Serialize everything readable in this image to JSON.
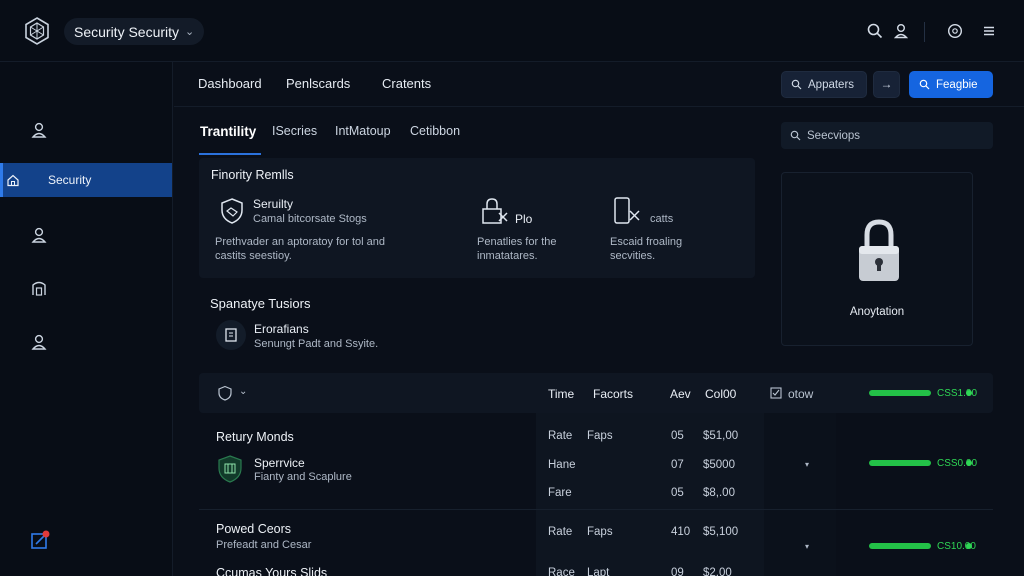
{
  "header": {
    "workspace_label": "Security Security",
    "workspace_chevron": "⌄"
  },
  "nav": {
    "links": [
      "Dashboard",
      "Penlscards",
      "Cratents"
    ],
    "search_button_label": "Appaters",
    "arrow_button_label": "→",
    "primary_button_label": "Feagbie"
  },
  "sidebar": {
    "items": [
      {
        "icon": "user-icon",
        "label": ""
      },
      {
        "icon": "home-shield-icon",
        "label": "Security"
      },
      {
        "icon": "user-icon",
        "label": ""
      },
      {
        "icon": "building-icon",
        "label": ""
      },
      {
        "icon": "user-icon",
        "label": ""
      }
    ],
    "bottom_icon": "edit-notification-icon"
  },
  "tabs": [
    "Trantility",
    "ISecries",
    "IntMatoup",
    "Cetibbon"
  ],
  "search": {
    "placeholder": "Seecviops"
  },
  "priority_card": {
    "title": "Finority Remlls",
    "features": [
      {
        "icon": "shield-icon",
        "title": "Seruilty",
        "subtitle": "Camal bitcorsate Stogs",
        "desc": "Prethvader an aptoratoy for tol and castits seestioy."
      },
      {
        "icon": "lock-x-icon",
        "title": "Plo",
        "subtitle": "",
        "desc": "Penatlies for the inmatatares."
      },
      {
        "icon": "phone-x-icon",
        "title": "catts",
        "subtitle": "",
        "desc": "Escaid froaling secvities."
      }
    ]
  },
  "lock_panel": {
    "label": "Anoytation"
  },
  "spanatye": {
    "title": "Spanatye Tusiors",
    "item_title": "Erorafians",
    "item_sub": "Senungt Padt and Ssyite."
  },
  "table": {
    "header_chevron": "⌄",
    "headers": [
      "Time",
      "Facorts",
      "Aev",
      "Col00",
      "otow"
    ],
    "groups": [
      {
        "title": "Retury Monds",
        "item_title": "Sperrvice",
        "item_sub": "Fianty and Scaplure",
        "rows": [
          {
            "time": "Rate",
            "facorts": "Faps",
            "aev": "05",
            "col": "$51,00"
          },
          {
            "time": "Hane",
            "facorts": "",
            "aev": "07",
            "col": "$5000"
          },
          {
            "time": "Fare",
            "facorts": "",
            "aev": "05",
            "col": "$8,.00"
          }
        ],
        "bar_value": "CSS1.00",
        "bar_level": 1.0
      },
      {
        "title": "Powed Ceors",
        "item_sub": "Prefeadt and Cesar",
        "rows": [
          {
            "time": "Rate",
            "facorts": "Faps",
            "aev": "410",
            "col": "$5,100"
          }
        ],
        "bar_value": "CS10.00",
        "bar_level": 1.0
      },
      {
        "title": "Ccumas Yours Slids",
        "rows": [
          {
            "time": "Race",
            "facorts": "Lapt",
            "aev": "09",
            "col": "$2,00"
          }
        ]
      }
    ],
    "header_bar_value": "CSS1.00",
    "middle_bar_value": "CSS0.00"
  },
  "colors": {
    "accent": "#1565e0",
    "active_nav": "#13428a",
    "success": "#23c147",
    "background": "#0a0f19"
  }
}
